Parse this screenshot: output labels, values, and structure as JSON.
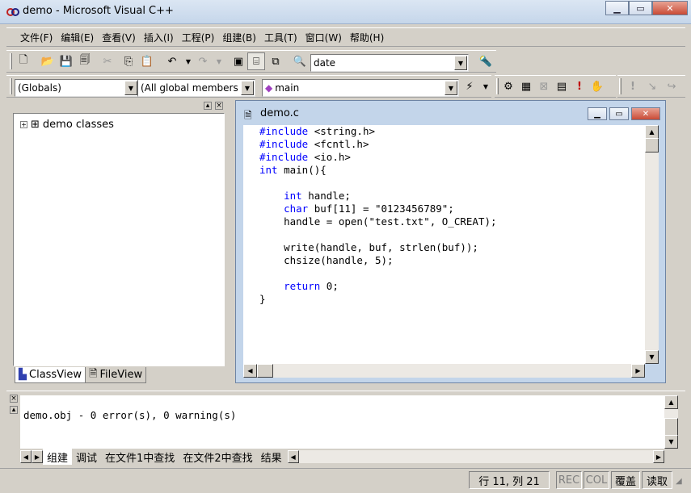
{
  "window": {
    "title": "demo - Microsoft Visual C++"
  },
  "menu": [
    "文件(F)",
    "编辑(E)",
    "查看(V)",
    "插入(I)",
    "工程(P)",
    "组建(B)",
    "工具(T)",
    "窗口(W)",
    "帮助(H)"
  ],
  "toolbar": {
    "find_combo_value": "date"
  },
  "wizardbar": {
    "scope": "(Globals)",
    "members": "(All global members",
    "function": "main"
  },
  "workspace": {
    "tree_root": "demo classes",
    "tabs": [
      "ClassView",
      "FileView"
    ],
    "active_tab": "ClassView"
  },
  "editor": {
    "title": "demo.c",
    "lines": [
      {
        "k": "#include",
        "t": " <string.h>"
      },
      {
        "k": "#include",
        "t": " <fcntl.h>"
      },
      {
        "k": "#include",
        "t": " <io.h>"
      },
      {
        "k": "int",
        "t": " main(){"
      },
      {
        "k": "",
        "t": ""
      },
      {
        "k": "    int",
        "t": " handle;"
      },
      {
        "k": "    char",
        "t": " buf[11] = \"0123456789\";"
      },
      {
        "k": "",
        "t": "    handle = open(\"test.txt\", O_CREAT);"
      },
      {
        "k": "",
        "t": ""
      },
      {
        "k": "",
        "t": "    write(handle, buf, strlen(buf));"
      },
      {
        "k": "",
        "t": "    chsize(handle, 5);"
      },
      {
        "k": "",
        "t": ""
      },
      {
        "k": "    return",
        "t": " 0;"
      },
      {
        "k": "",
        "t": "}"
      }
    ]
  },
  "output": {
    "text": "demo.obj - 0 error(s), 0 warning(s)",
    "tabs": [
      "组建",
      "调试",
      "在文件1中查找",
      "在文件2中查找",
      "结果"
    ]
  },
  "status": {
    "position": "行 11, 列 21",
    "rec": "REC",
    "col": "COL",
    "ovr": "覆盖",
    "read": "读取"
  },
  "colors": {
    "keyword": "#0000ff",
    "title_gradient_top": "#dbe6f3",
    "face": "#d4d0c8"
  }
}
